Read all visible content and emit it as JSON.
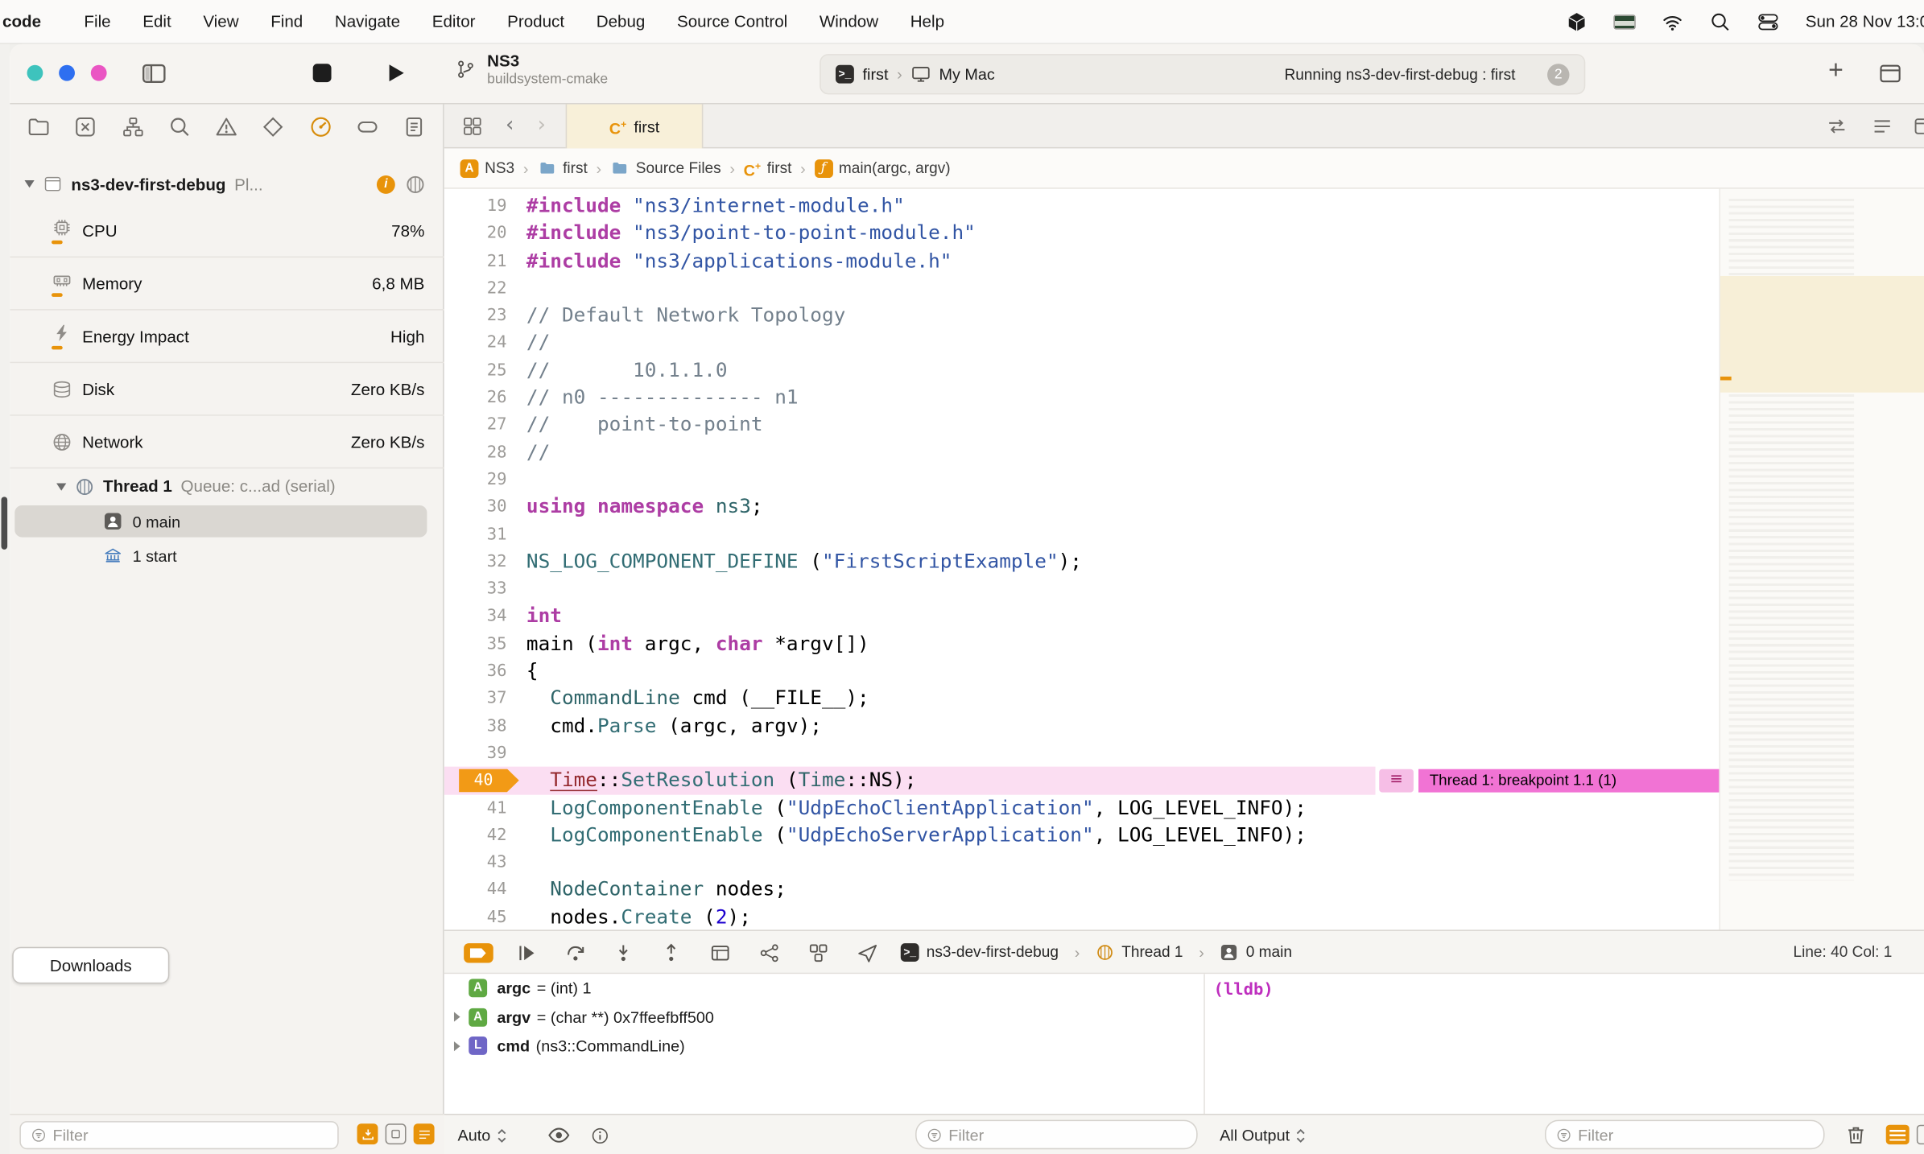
{
  "menu_bar": {
    "app_name": "code",
    "items": [
      "File",
      "Edit",
      "View",
      "Find",
      "Navigate",
      "Editor",
      "Product",
      "Debug",
      "Source Control",
      "Window",
      "Help"
    ],
    "clock": "Sun 28 Nov 13:0"
  },
  "toolbar": {
    "project_title": "NS3",
    "project_subtitle": "buildsystem-cmake",
    "scheme": "first",
    "run_destination": "My Mac",
    "activity_status": "Running ns3-dev-first-debug : first",
    "issue_badge": "2"
  },
  "navigator": {
    "process": {
      "name": "ns3-dev-first-debug",
      "detail": "Pl..."
    },
    "gauges": [
      {
        "label": "CPU",
        "value": "78%",
        "icon": "chip",
        "tick": true
      },
      {
        "label": "Memory",
        "value": "6,8 MB",
        "icon": "mem",
        "tick": true
      },
      {
        "label": "Energy Impact",
        "value": "High",
        "icon": "bolt",
        "tick": true
      },
      {
        "label": "Disk",
        "value": "Zero KB/s",
        "icon": "disk",
        "tick": false
      },
      {
        "label": "Network",
        "value": "Zero KB/s",
        "icon": "globe",
        "tick": false
      }
    ],
    "thread": {
      "name": "Thread 1",
      "detail": "Queue: c...ad (serial)"
    },
    "frames": [
      {
        "index": "0",
        "name": "main",
        "icon": "person",
        "selected": true
      },
      {
        "index": "1",
        "name": "start",
        "icon": "bank",
        "selected": false
      }
    ],
    "downloads_button": "Downloads",
    "filter_placeholder": "Filter"
  },
  "editor": {
    "tab_label": "first",
    "breadcrumbs": [
      {
        "label": "NS3",
        "icon": "app"
      },
      {
        "label": "first",
        "icon": "folder"
      },
      {
        "label": "Source Files",
        "icon": "folder"
      },
      {
        "label": "first",
        "icon": "c-file"
      },
      {
        "label": "main(argc, argv)",
        "icon": "function"
      }
    ],
    "breakpoint_annotation": "Thread 1: breakpoint 1.1 (1)",
    "code_lines": [
      {
        "n": 19,
        "t": [
          [
            "pre",
            "#include"
          ],
          [
            "pl",
            " "
          ],
          [
            "str",
            "\"ns3/internet-module.h\""
          ]
        ]
      },
      {
        "n": 20,
        "t": [
          [
            "pre",
            "#include"
          ],
          [
            "pl",
            " "
          ],
          [
            "str",
            "\"ns3/point-to-point-module.h\""
          ]
        ]
      },
      {
        "n": 21,
        "t": [
          [
            "pre",
            "#include"
          ],
          [
            "pl",
            " "
          ],
          [
            "str",
            "\"ns3/applications-module.h\""
          ]
        ]
      },
      {
        "n": 22,
        "t": []
      },
      {
        "n": 23,
        "t": [
          [
            "com",
            "// Default Network Topology"
          ]
        ]
      },
      {
        "n": 24,
        "t": [
          [
            "com",
            "//"
          ]
        ]
      },
      {
        "n": 25,
        "t": [
          [
            "com",
            "//       10.1.1.0"
          ]
        ]
      },
      {
        "n": 26,
        "t": [
          [
            "com",
            "// n0 -------------- n1"
          ]
        ]
      },
      {
        "n": 27,
        "t": [
          [
            "com",
            "//    point-to-point"
          ]
        ]
      },
      {
        "n": 28,
        "t": [
          [
            "com",
            "//"
          ]
        ]
      },
      {
        "n": 29,
        "t": []
      },
      {
        "n": 30,
        "t": [
          [
            "pre",
            "using"
          ],
          [
            "pl",
            " "
          ],
          [
            "pre",
            "namespace"
          ],
          [
            "pl",
            " "
          ],
          [
            "typ",
            "ns3"
          ],
          [
            "pl",
            ";"
          ]
        ]
      },
      {
        "n": 31,
        "t": []
      },
      {
        "n": 32,
        "t": [
          [
            "fn",
            "NS_LOG_COMPONENT_DEFINE"
          ],
          [
            "pl",
            " ("
          ],
          [
            "str",
            "\"FirstScriptExample\""
          ],
          [
            "pl",
            ");"
          ]
        ]
      },
      {
        "n": 33,
        "t": []
      },
      {
        "n": 34,
        "t": [
          [
            "pre",
            "int"
          ]
        ]
      },
      {
        "n": 35,
        "t": [
          [
            "pl",
            "main ("
          ],
          [
            "pre",
            "int"
          ],
          [
            "pl",
            " argc, "
          ],
          [
            "pre",
            "char"
          ],
          [
            "pl",
            " *argv[])"
          ]
        ]
      },
      {
        "n": 36,
        "t": [
          [
            "pl",
            "{"
          ]
        ]
      },
      {
        "n": 37,
        "t": [
          [
            "pl",
            "  "
          ],
          [
            "typ",
            "CommandLine"
          ],
          [
            "pl",
            " cmd (__FILE__);"
          ]
        ]
      },
      {
        "n": 38,
        "t": [
          [
            "pl",
            "  cmd."
          ],
          [
            "fn",
            "Parse"
          ],
          [
            "pl",
            " (argc, argv);"
          ]
        ]
      },
      {
        "n": 39,
        "t": []
      },
      {
        "n": 40,
        "bp": true,
        "t": [
          [
            "pl",
            "  "
          ],
          [
            "cur",
            "Time"
          ],
          [
            "pl",
            "::"
          ],
          [
            "fn",
            "SetResolution"
          ],
          [
            "pl",
            " ("
          ],
          [
            "typ",
            "Time"
          ],
          [
            "pl",
            "::NS);"
          ]
        ]
      },
      {
        "n": 41,
        "t": [
          [
            "pl",
            "  "
          ],
          [
            "fn",
            "LogComponentEnable"
          ],
          [
            "pl",
            " ("
          ],
          [
            "str",
            "\"UdpEchoClientApplication\""
          ],
          [
            "pl",
            ", LOG_LEVEL_INFO);"
          ]
        ]
      },
      {
        "n": 42,
        "t": [
          [
            "pl",
            "  "
          ],
          [
            "fn",
            "LogComponentEnable"
          ],
          [
            "pl",
            " ("
          ],
          [
            "str",
            "\"UdpEchoServerApplication\""
          ],
          [
            "pl",
            ", LOG_LEVEL_INFO);"
          ]
        ]
      },
      {
        "n": 43,
        "t": []
      },
      {
        "n": 44,
        "t": [
          [
            "pl",
            "  "
          ],
          [
            "typ",
            "NodeContainer"
          ],
          [
            "pl",
            " nodes;"
          ]
        ]
      },
      {
        "n": 45,
        "t": [
          [
            "pl",
            "  nodes."
          ],
          [
            "fn",
            "Create"
          ],
          [
            "pl",
            " ("
          ],
          [
            "num",
            "2"
          ],
          [
            "pl",
            ");"
          ]
        ]
      }
    ]
  },
  "debug_bar": {
    "process": "ns3-dev-first-debug",
    "thread": "Thread 1",
    "frame": "0 main",
    "position": "Line: 40  Col: 1"
  },
  "variables": [
    {
      "badge": "A",
      "badge_color": "#5fa943",
      "name": "argc",
      "value": "= (int) 1",
      "expandable": false
    },
    {
      "badge": "A",
      "badge_color": "#5fa943",
      "name": "argv",
      "value": "= (char **) 0x7ffeefbff500",
      "expandable": true
    },
    {
      "badge": "L",
      "badge_color": "#6f66c6",
      "name": "cmd",
      "value": "(ns3::CommandLine)",
      "expandable": true
    }
  ],
  "console": {
    "prompt": "(lldb)",
    "scope_selector": "Auto",
    "output_selector": "All Output",
    "variables_filter_placeholder": "Filter",
    "console_filter_placeholder": "Filter"
  }
}
